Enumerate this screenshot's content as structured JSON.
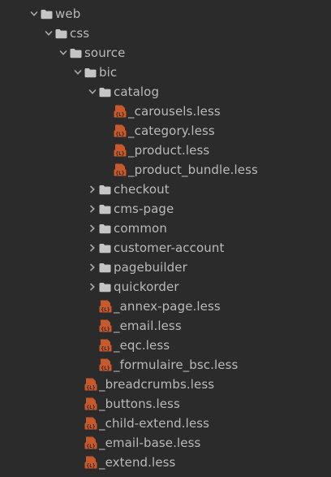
{
  "colors": {
    "background": "#2b2b2b",
    "text": "#bababa",
    "folder": "#c5c5c5",
    "chevron": "#a9a9a9",
    "less_icon_bg": "#c75a2c",
    "less_icon_text": "#1e1e1e"
  },
  "tree": {
    "rows": [
      {
        "label": "web",
        "kind": "folder",
        "state": "expanded",
        "depth": 0
      },
      {
        "label": "css",
        "kind": "folder",
        "state": "expanded",
        "depth": 1
      },
      {
        "label": "source",
        "kind": "folder",
        "state": "expanded",
        "depth": 2
      },
      {
        "label": "bic",
        "kind": "folder",
        "state": "expanded",
        "depth": 3
      },
      {
        "label": "catalog",
        "kind": "folder",
        "state": "expanded",
        "depth": 4
      },
      {
        "label": "_carousels.less",
        "kind": "less",
        "depth": 5
      },
      {
        "label": "_category.less",
        "kind": "less",
        "depth": 5
      },
      {
        "label": "_product.less",
        "kind": "less",
        "depth": 5
      },
      {
        "label": "_product_bundle.less",
        "kind": "less",
        "depth": 5
      },
      {
        "label": "checkout",
        "kind": "folder",
        "state": "collapsed",
        "depth": 4
      },
      {
        "label": "cms-page",
        "kind": "folder",
        "state": "collapsed",
        "depth": 4
      },
      {
        "label": "common",
        "kind": "folder",
        "state": "collapsed",
        "depth": 4
      },
      {
        "label": "customer-account",
        "kind": "folder",
        "state": "collapsed",
        "depth": 4
      },
      {
        "label": "pagebuilder",
        "kind": "folder",
        "state": "collapsed",
        "depth": 4
      },
      {
        "label": "quickorder",
        "kind": "folder",
        "state": "collapsed",
        "depth": 4
      },
      {
        "label": "_annex-page.less",
        "kind": "less",
        "depth": 4
      },
      {
        "label": "_email.less",
        "kind": "less",
        "depth": 4
      },
      {
        "label": "_eqc.less",
        "kind": "less",
        "depth": 4
      },
      {
        "label": "_formulaire_bsc.less",
        "kind": "less",
        "depth": 4
      },
      {
        "label": "_breadcrumbs.less",
        "kind": "less",
        "depth": 3
      },
      {
        "label": "_buttons.less",
        "kind": "less",
        "depth": 3
      },
      {
        "label": "_child-extend.less",
        "kind": "less",
        "depth": 3
      },
      {
        "label": "_email-base.less",
        "kind": "less",
        "depth": 3
      },
      {
        "label": "_extend.less",
        "kind": "less",
        "depth": 3
      }
    ]
  }
}
